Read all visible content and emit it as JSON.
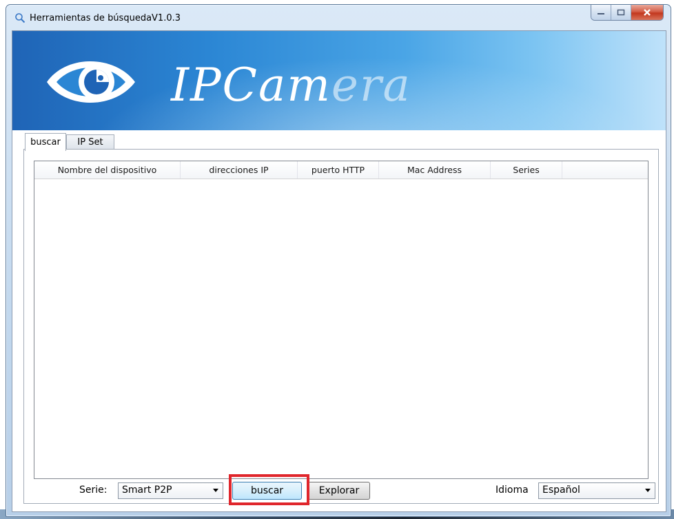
{
  "window": {
    "title": "Herramientas de búsquedaV1.0.3",
    "controls": {
      "minimize": "",
      "maximize": "",
      "close": "x"
    }
  },
  "banner": {
    "logo_text_main": "IPCam",
    "logo_text_faded": "era"
  },
  "tabs": [
    {
      "label": "buscar",
      "active": true
    },
    {
      "label": "IP Set",
      "active": false
    }
  ],
  "device_list": {
    "columns": [
      "Nombre del dispositivo",
      "direcciones IP",
      "puerto HTTP",
      "Mac Address",
      "Series"
    ],
    "rows": []
  },
  "bottom_bar": {
    "serie_label": "Serie:",
    "serie_value": "Smart P2P",
    "buscar_button": "buscar",
    "explorar_button": "Explorar",
    "idioma_label": "Idioma",
    "idioma_value": "Español"
  },
  "colors": {
    "highlight": "#e0262c",
    "banner_start": "#1f64b6",
    "banner_end": "#bfe2fa"
  },
  "icons": {
    "title": "search-icon",
    "logo": "eye-logo-icon",
    "combo_arrow": "chevron-down-icon"
  }
}
